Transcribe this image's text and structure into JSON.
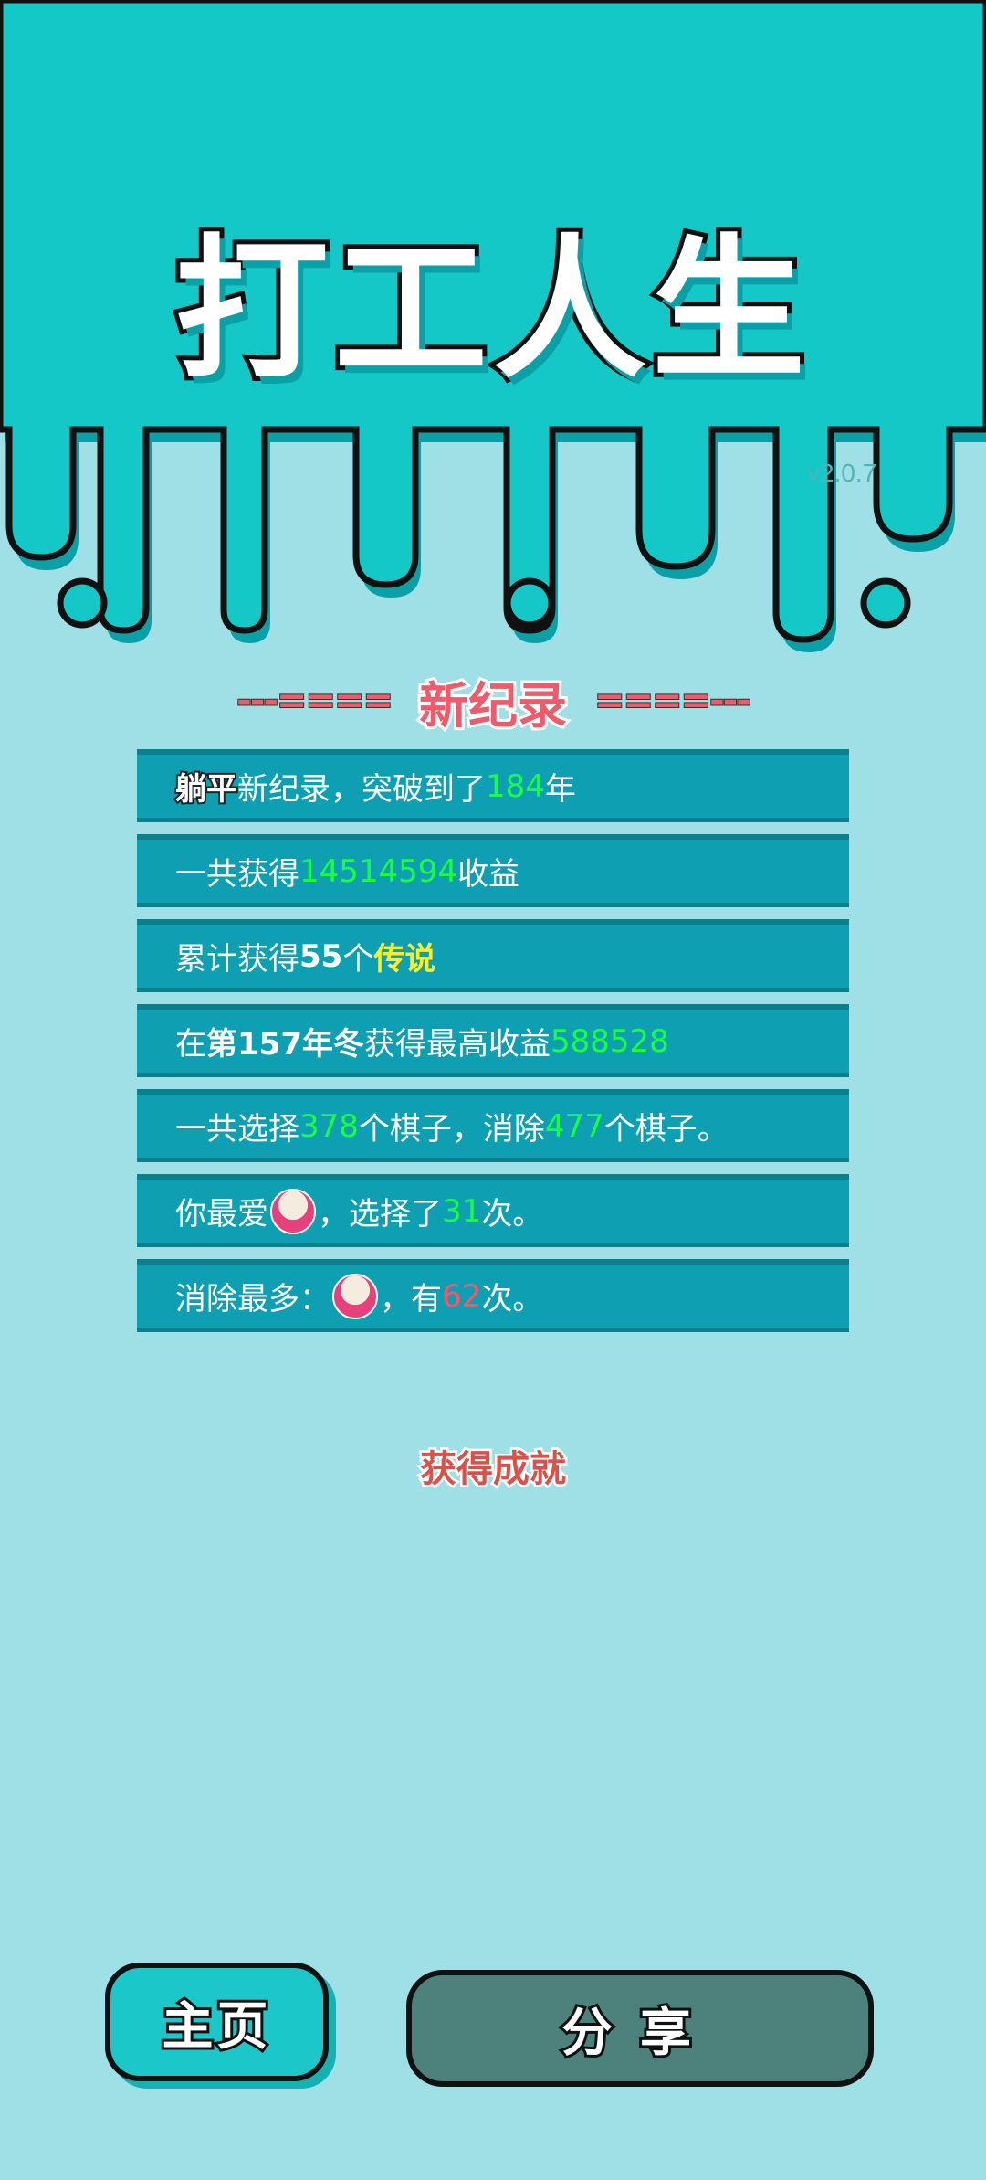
{
  "title": "打工人生",
  "version": "v2.0.7",
  "record": {
    "dashes_left": "---====",
    "title": "新纪录",
    "dashes_right": "====---"
  },
  "rows": [
    {
      "parts": [
        {
          "t": "躺平",
          "c": "bl"
        },
        {
          "t": "新纪录，突破到了"
        },
        {
          "t": "184",
          "c": "green"
        },
        {
          "t": "年"
        }
      ]
    },
    {
      "parts": [
        {
          "t": "一共获得"
        },
        {
          "t": "14514594",
          "c": "green"
        },
        {
          "t": "收益"
        }
      ]
    },
    {
      "parts": [
        {
          "t": "累计获得"
        },
        {
          "t": "55",
          "c": "hl"
        },
        {
          "t": "个 "
        },
        {
          "t": "传说",
          "c": "yellow"
        }
      ]
    },
    {
      "parts": [
        {
          "t": "在 "
        },
        {
          "t": "第157年冬",
          "c": "hl"
        },
        {
          "t": " 获得最高收益"
        },
        {
          "t": "588528",
          "c": "green"
        }
      ]
    },
    {
      "parts": [
        {
          "t": "一共选择"
        },
        {
          "t": "378",
          "c": "green"
        },
        {
          "t": "个棋子，消除"
        },
        {
          "t": "477",
          "c": "green"
        },
        {
          "t": "个棋子。"
        }
      ]
    },
    {
      "parts": [
        {
          "t": "你最爱"
        },
        {
          "icon": "rice-bowl-icon"
        },
        {
          "t": "，选择了"
        },
        {
          "t": "31",
          "c": "green"
        },
        {
          "t": "次。"
        }
      ]
    },
    {
      "parts": [
        {
          "t": "消除最多："
        },
        {
          "icon": "rice-bowl-icon"
        },
        {
          "t": "，有"
        },
        {
          "t": "62",
          "c": "red"
        },
        {
          "t": "次。"
        }
      ]
    }
  ],
  "achievement": "获得成就",
  "buttons": {
    "home": "主页",
    "share": "分享"
  },
  "colors": {
    "top": "#14c8c8",
    "background": "#9ee0e6",
    "row": "#0ea0b2",
    "accent": "#ef5b6a",
    "value": "#19ff3a"
  }
}
